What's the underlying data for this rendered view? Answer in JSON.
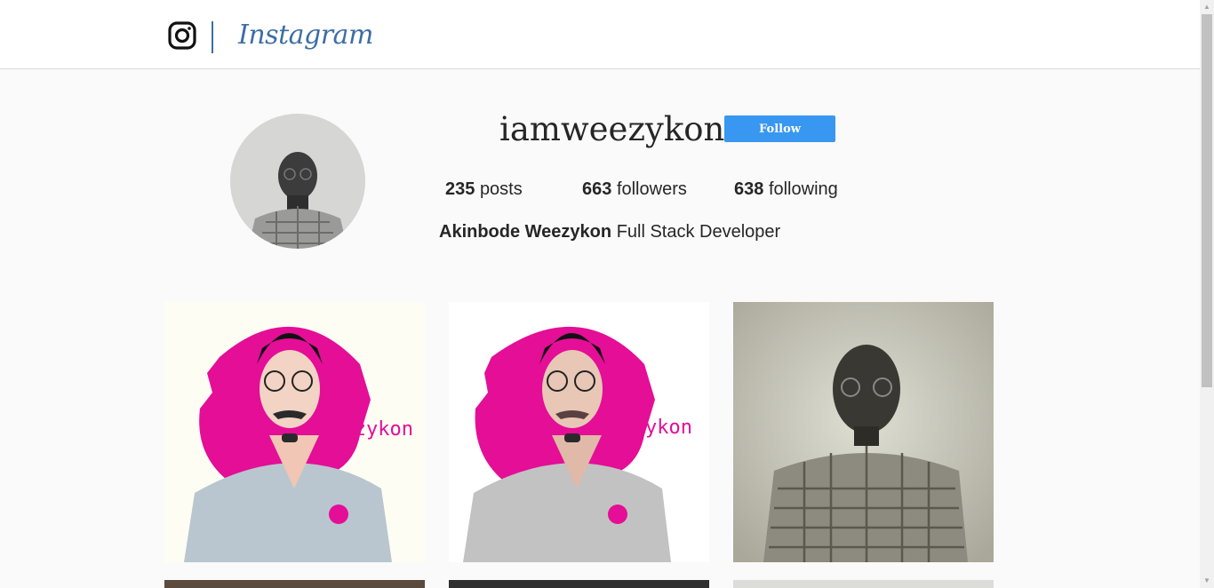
{
  "header": {
    "logo_icon": "instagram-camera-icon",
    "wordmark": "Instagram",
    "accent": "#3d6ea5"
  },
  "profile": {
    "username": "iamweezykon",
    "follow_label": "Follow",
    "follow_color": "#3897f0",
    "stats": {
      "posts_count": "235",
      "posts_label": "posts",
      "followers_count": "663",
      "followers_label": "followers",
      "following_count": "638",
      "following_label": "following"
    },
    "full_name": "Akinbode Weezykon",
    "bio": "Full Stack Developer"
  },
  "posts": [
    {
      "kind": "illustration",
      "caption_text": "Weezykon",
      "bg": "#fdfdf4",
      "accent": "#e40e97",
      "shirt": "#b9c6cf"
    },
    {
      "kind": "illustration",
      "caption_text": "Weezykon",
      "bg": "#ffffff",
      "accent": "#e40e97",
      "shirt": "#c2c2c2"
    },
    {
      "kind": "photo",
      "bg": "#cdccbf"
    }
  ]
}
